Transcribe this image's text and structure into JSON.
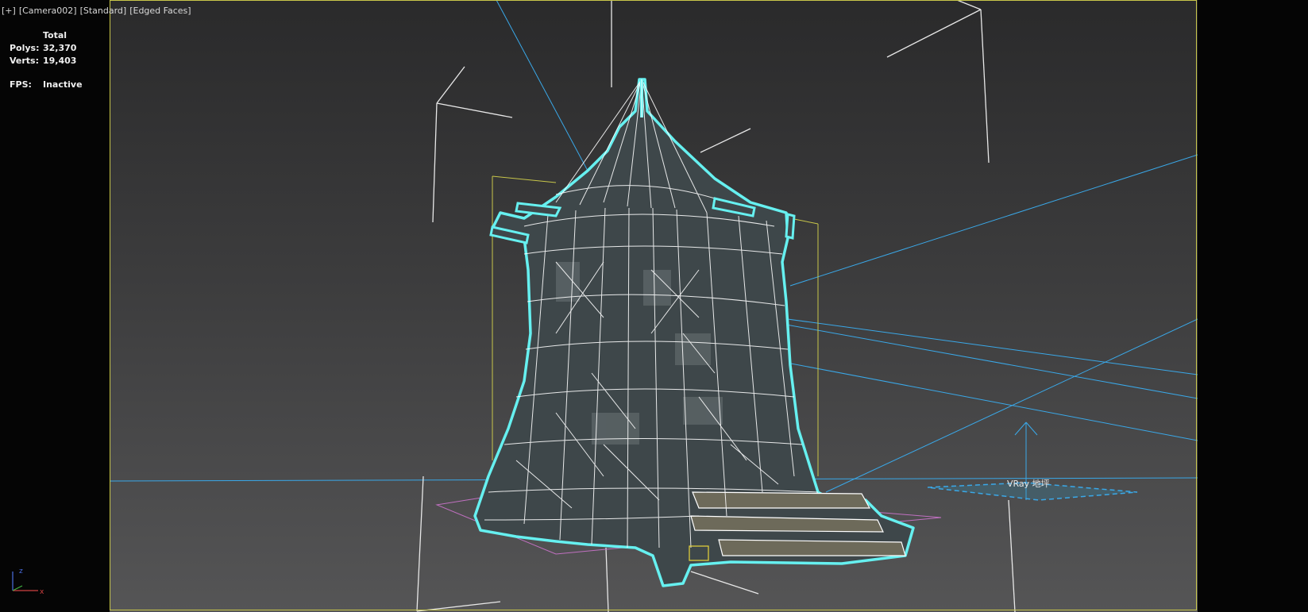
{
  "viewport": {
    "plus": "[+]",
    "camera": "[Camera002]",
    "shading_style": "[Standard]",
    "display_mode": "[Edged Faces]"
  },
  "stats": {
    "header": "Total",
    "polys_label": "Polys:",
    "polys_value": "32,370",
    "verts_label": "Verts:",
    "verts_value": "19,403",
    "fps_label": "FPS:",
    "fps_value": "Inactive"
  },
  "scene": {
    "ground_object_label": "VRay 地坪",
    "colors": {
      "selection_outline": "#66f0f0",
      "wireframe": "#ffffff",
      "light_lines": "#3aa8e8",
      "bounding_box": "#c8c64a",
      "ground_plane": "#c070c0",
      "mesh_fill": "#3c4548"
    }
  },
  "axis_gizmo": {
    "z": "z",
    "x": "x"
  }
}
